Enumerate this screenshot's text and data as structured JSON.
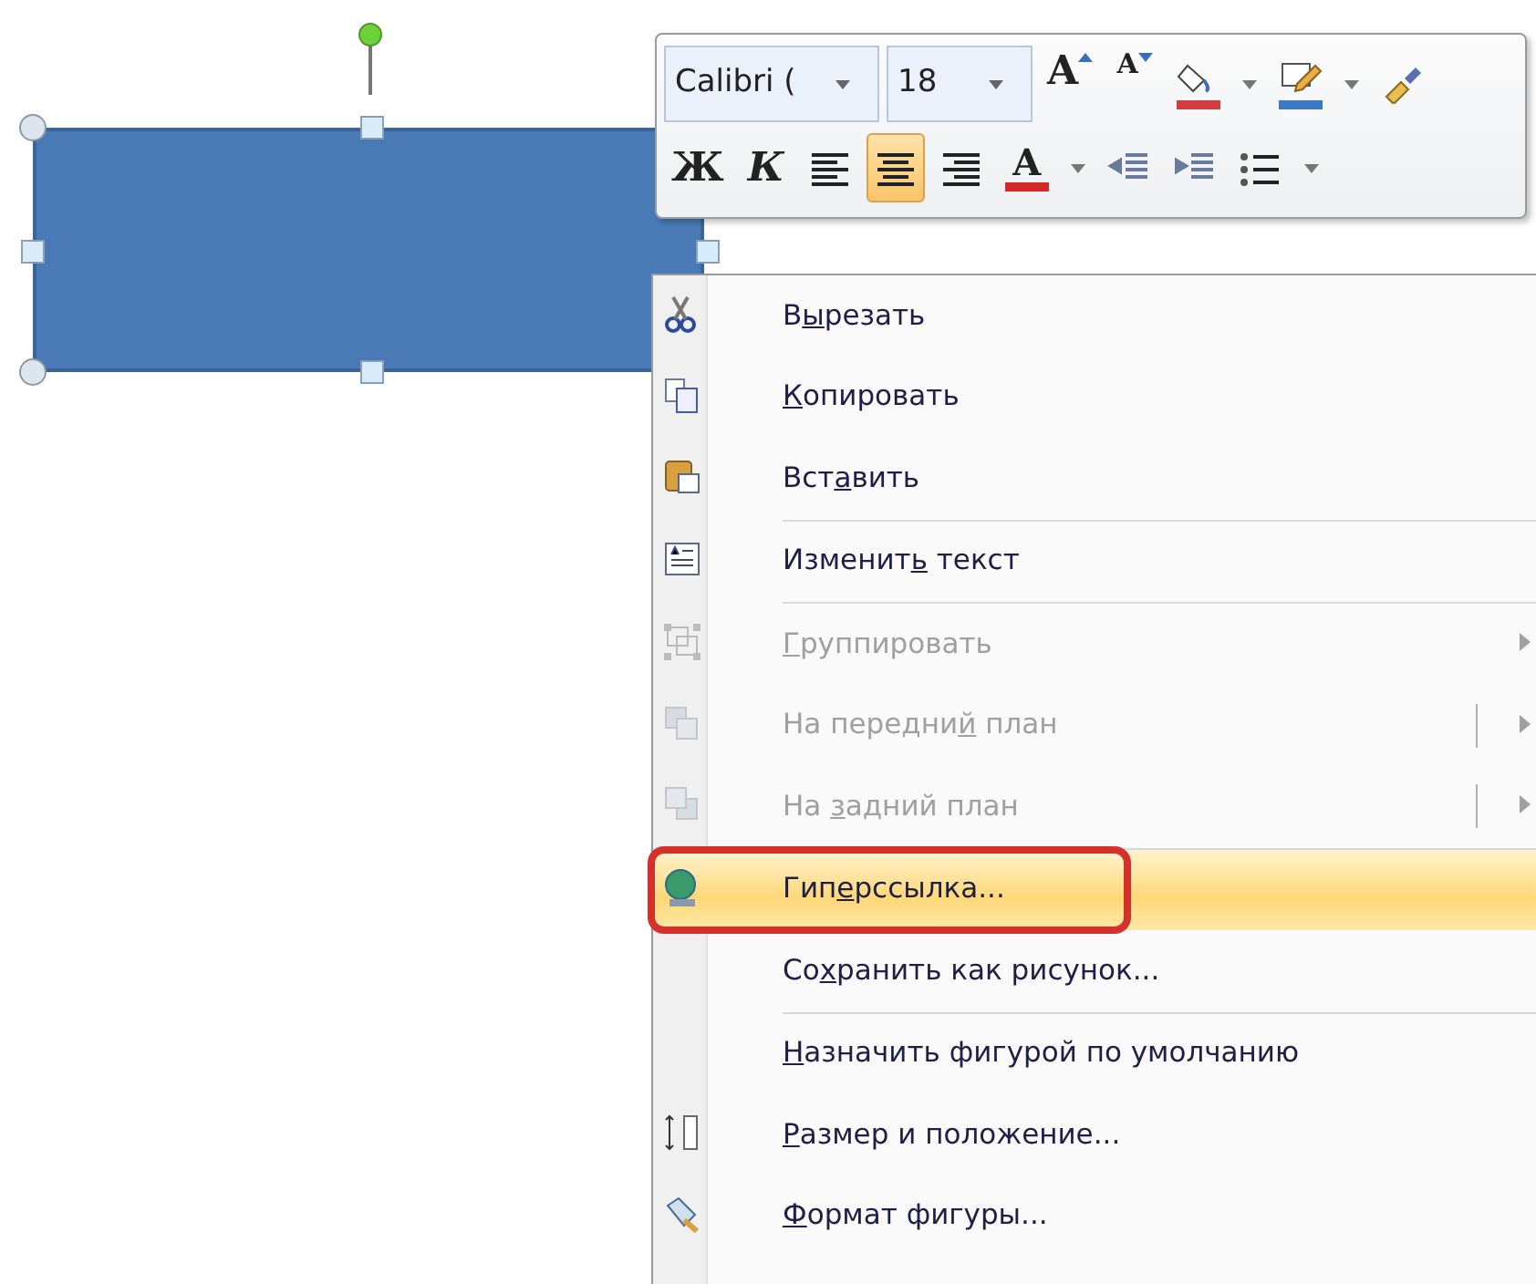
{
  "shape": {
    "selected": true
  },
  "mini_toolbar": {
    "font_name": "Calibri (",
    "font_size": "18",
    "row_1": [
      {
        "kind": "grow",
        "label": "A",
        "selected": false
      },
      {
        "kind": "shrink",
        "label": "A",
        "selected": false
      },
      {
        "kind": "fill",
        "color": "#d23c3c",
        "selected": false
      },
      {
        "kind": "outline",
        "color": "#3c78c8",
        "selected": false
      },
      {
        "kind": "painter",
        "selected": false
      }
    ],
    "row_2": [
      {
        "kind": "bold",
        "label": "Ж",
        "selected": false
      },
      {
        "kind": "italic",
        "label": "К",
        "selected": false
      },
      {
        "kind": "align-left",
        "selected": false
      },
      {
        "kind": "align-center",
        "selected": true
      },
      {
        "kind": "align-right",
        "selected": false
      },
      {
        "kind": "font-color",
        "label": "A",
        "color": "#d42a2a",
        "selected": false
      },
      {
        "kind": "outdent",
        "selected": false
      },
      {
        "kind": "indent",
        "selected": false
      },
      {
        "kind": "bullets",
        "selected": false
      }
    ]
  },
  "context_menu": [
    {
      "kind": "item",
      "label_start": "В",
      "access_key": "ы",
      "label_end": "резать",
      "disabled": false,
      "selected": false,
      "circled": false
    },
    {
      "kind": "item",
      "access_key": "К",
      "label_end": "опировать",
      "disabled": false,
      "selected": false,
      "circled": false
    },
    {
      "kind": "item",
      "label_start": "Вст",
      "access_key": "а",
      "label_end": "вить",
      "disabled": false,
      "selected": false,
      "circled": false
    },
    {
      "kind": "separator"
    },
    {
      "kind": "item",
      "label_start": "Изменит",
      "access_key": "ь",
      "label_end": " текст",
      "disabled": false,
      "selected": false,
      "circled": false
    },
    {
      "kind": "separator"
    },
    {
      "kind": "submenu",
      "access_key": "Г",
      "label_end": "руппировать",
      "disabled": true,
      "selected": false,
      "circled": false
    },
    {
      "kind": "split",
      "label_start": "На передни",
      "access_key": "й",
      "label_end": " план",
      "disabled": true,
      "selected": false,
      "circled": false
    },
    {
      "kind": "split",
      "label_start": "На ",
      "access_key": "з",
      "label_end": "адний план",
      "disabled": true,
      "selected": false,
      "circled": false
    },
    {
      "kind": "separator"
    },
    {
      "kind": "item",
      "label_start": "Гип",
      "access_key": "е",
      "label_end": "рссылка...",
      "disabled": false,
      "selected": true,
      "circled": true
    },
    {
      "kind": "item",
      "label_start": "Со",
      "access_key": "х",
      "label_end": "ранить как рисунок...",
      "disabled": false,
      "selected": false,
      "circled": false
    },
    {
      "kind": "separator"
    },
    {
      "kind": "item",
      "access_key": "Н",
      "label_end": "азначить фигурой по умолчанию",
      "disabled": false,
      "selected": false,
      "circled": false
    },
    {
      "kind": "item",
      "access_key": "Р",
      "label_end": "азмер и положение...",
      "disabled": false,
      "selected": false,
      "circled": false
    },
    {
      "kind": "item",
      "access_key": "Ф",
      "label_end": "ормат фигуры...",
      "disabled": false,
      "selected": false,
      "circled": false
    }
  ]
}
